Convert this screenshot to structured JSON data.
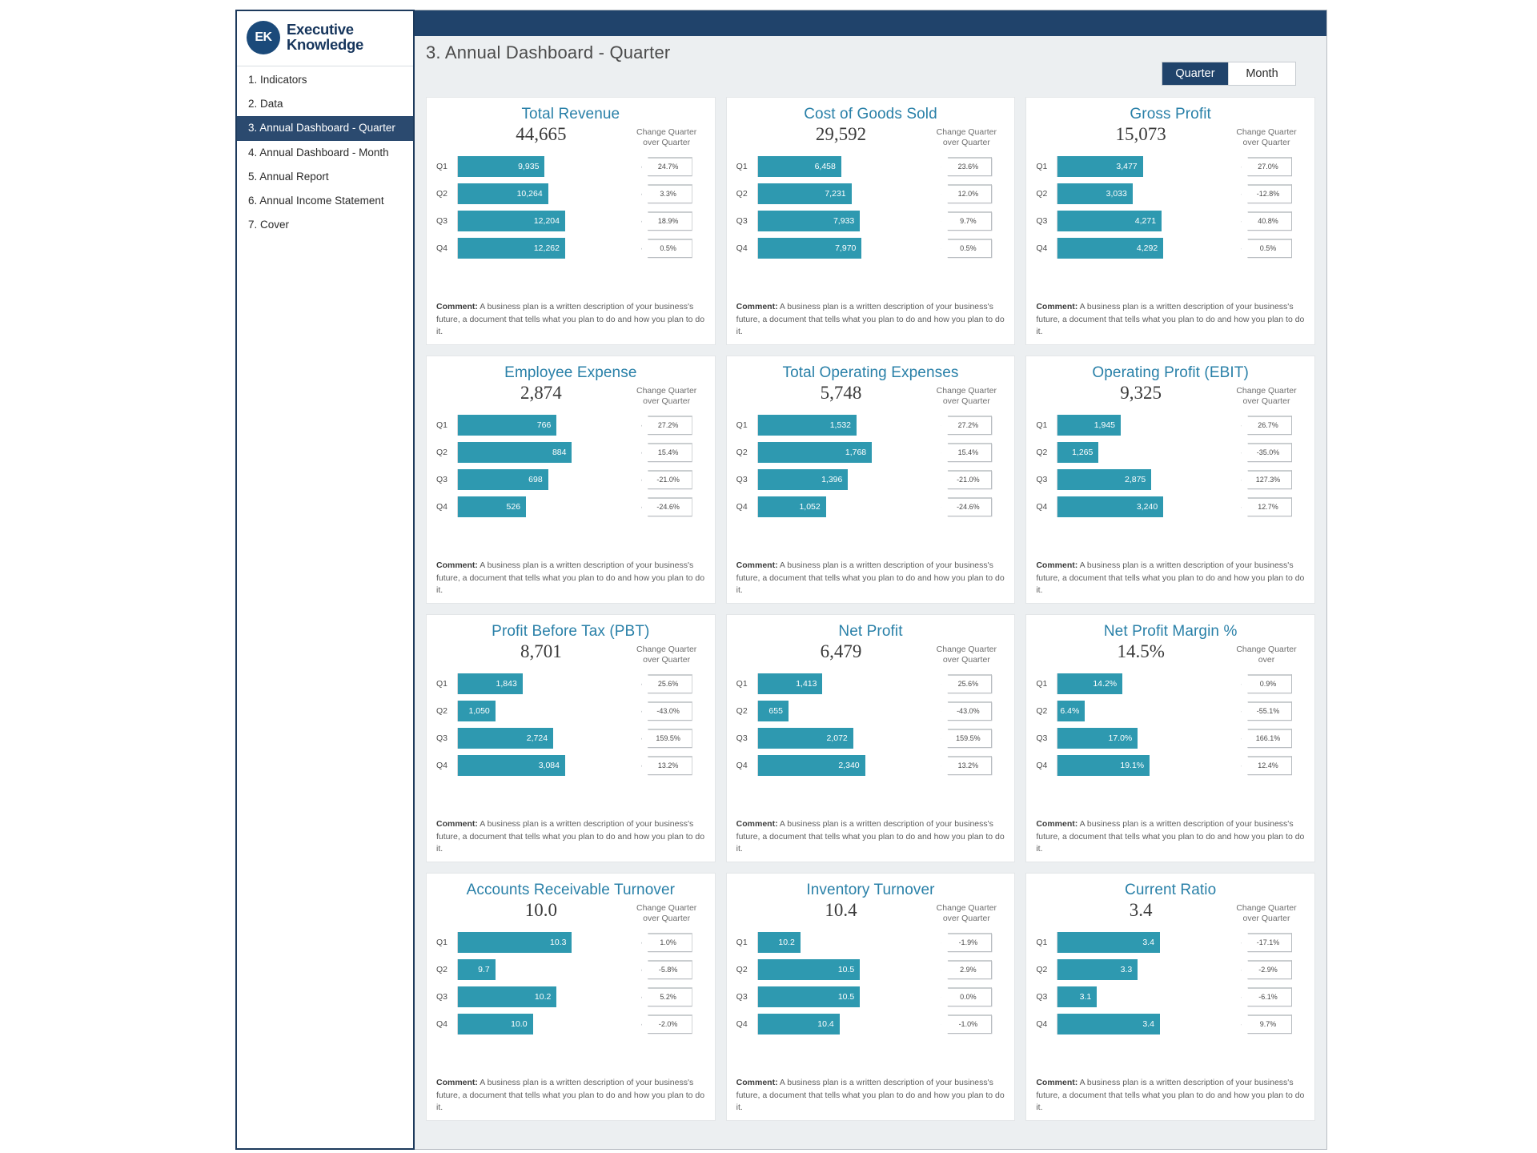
{
  "brand": {
    "mark": "EK",
    "line1": "Executive",
    "line2": "Knowledge"
  },
  "sidebar": {
    "items": [
      {
        "label": "1. Indicators",
        "active": false
      },
      {
        "label": "2. Data",
        "active": false
      },
      {
        "label": "3. Annual Dashboard - Quarter",
        "active": true
      },
      {
        "label": "4. Annual Dashboard - Month",
        "active": false
      },
      {
        "label": "5. Annual Report",
        "active": false
      },
      {
        "label": "6. Annual Income Statement",
        "active": false
      },
      {
        "label": "7. Cover",
        "active": false
      }
    ]
  },
  "header": {
    "title": "3. Annual Dashboard - Quarter",
    "toggle": [
      {
        "label": "Quarter",
        "active": true
      },
      {
        "label": "Month",
        "active": false
      }
    ]
  },
  "labels": {
    "change_header": "Change Quarter over Quarter",
    "change_header_short": "Change Quarter over",
    "comment_prefix": "Comment:",
    "comment_body": "A business plan is a written description of your business's future, a document that tells what you plan to do and how you plan to do it."
  },
  "colors": {
    "bar": "#2e99b0",
    "accent": "#20436b",
    "title": "#2980a8",
    "panel": "#eceff1"
  },
  "chart_data": [
    {
      "type": "bar",
      "title": "Total Revenue",
      "total": "44,665",
      "categories": [
        "Q1",
        "Q2",
        "Q3",
        "Q4"
      ],
      "values": [
        9935,
        10264,
        12204,
        12262
      ],
      "value_labels": [
        "9,935",
        "10,264",
        "12,204",
        "12,262"
      ],
      "bar_pct": [
        51,
        53,
        63,
        63
      ],
      "change": [
        "24.7%",
        "3.3%",
        "18.9%",
        "0.5%"
      ],
      "change_header": "Change Quarter over Quarter",
      "xlabel": "",
      "ylabel": "",
      "comment": "A business plan is a written description of your business's future, a document that tells what you plan to do and how you plan to do it."
    },
    {
      "type": "bar",
      "title": "Cost of Goods Sold",
      "total": "29,592",
      "categories": [
        "Q1",
        "Q2",
        "Q3",
        "Q4"
      ],
      "values": [
        6458,
        7231,
        7933,
        7970
      ],
      "value_labels": [
        "6,458",
        "7,231",
        "7,933",
        "7,970"
      ],
      "bar_pct": [
        49,
        55,
        60,
        61
      ],
      "change": [
        "23.6%",
        "12.0%",
        "9.7%",
        "0.5%"
      ],
      "change_header": "Change Quarter over Quarter",
      "xlabel": "",
      "ylabel": "",
      "comment": "A business plan is a written description of your business's future, a document that tells what you plan to do and how you plan to do it."
    },
    {
      "type": "bar",
      "title": "Gross Profit",
      "total": "15,073",
      "categories": [
        "Q1",
        "Q2",
        "Q3",
        "Q4"
      ],
      "values": [
        3477,
        3033,
        4271,
        4292
      ],
      "value_labels": [
        "3,477",
        "3,033",
        "4,271",
        "4,292"
      ],
      "bar_pct": [
        50,
        44,
        61,
        62
      ],
      "change": [
        "27.0%",
        "-12.8%",
        "40.8%",
        "0.5%"
      ],
      "change_header": "Change Quarter over Quarter",
      "xlabel": "",
      "ylabel": "",
      "comment": "A business plan is a written description of your business's future, a document that tells what you plan to do and how you plan to do it."
    },
    {
      "type": "bar",
      "title": "Employee Expense",
      "total": "2,874",
      "categories": [
        "Q1",
        "Q2",
        "Q3",
        "Q4"
      ],
      "values": [
        766,
        884,
        698,
        526
      ],
      "value_labels": [
        "766",
        "884",
        "698",
        "526"
      ],
      "bar_pct": [
        58,
        67,
        53,
        40
      ],
      "change": [
        "27.2%",
        "15.4%",
        "-21.0%",
        "-24.6%"
      ],
      "change_header": "Change Quarter over Quarter",
      "xlabel": "",
      "ylabel": "",
      "comment": "A business plan is a written description of your business's future, a document that tells what you plan to do and how you plan to do it."
    },
    {
      "type": "bar",
      "title": "Total Operating Expenses",
      "total": "5,748",
      "categories": [
        "Q1",
        "Q2",
        "Q3",
        "Q4"
      ],
      "values": [
        1532,
        1768,
        1396,
        1052
      ],
      "value_labels": [
        "1,532",
        "1,768",
        "1,396",
        "1,052"
      ],
      "bar_pct": [
        58,
        67,
        53,
        40
      ],
      "change": [
        "27.2%",
        "15.4%",
        "-21.0%",
        "-24.6%"
      ],
      "change_header": "Change Quarter over Quarter",
      "xlabel": "",
      "ylabel": "",
      "comment": "A business plan is a written description of your business's future, a document that tells what you plan to do and how you plan to do it."
    },
    {
      "type": "bar",
      "title": "Operating Profit (EBIT)",
      "total": "9,325",
      "categories": [
        "Q1",
        "Q2",
        "Q3",
        "Q4"
      ],
      "values": [
        1945,
        1265,
        2875,
        3240
      ],
      "value_labels": [
        "1,945",
        "1,265",
        "2,875",
        "3,240"
      ],
      "bar_pct": [
        37,
        24,
        55,
        62
      ],
      "change": [
        "26.7%",
        "-35.0%",
        "127.3%",
        "12.7%"
      ],
      "change_header": "Change Quarter over Quarter",
      "xlabel": "",
      "ylabel": "",
      "comment": "A business plan is a written description of your business's future, a document that tells what you plan to do and how you plan to do it."
    },
    {
      "type": "bar",
      "title": "Profit Before Tax (PBT)",
      "total": "8,701",
      "categories": [
        "Q1",
        "Q2",
        "Q3",
        "Q4"
      ],
      "values": [
        1843,
        1050,
        2724,
        3084
      ],
      "value_labels": [
        "1,843",
        "1,050",
        "2,724",
        "3,084"
      ],
      "bar_pct": [
        38,
        22,
        56,
        63
      ],
      "change": [
        "25.6%",
        "-43.0%",
        "159.5%",
        "13.2%"
      ],
      "change_header": "Change Quarter over Quarter",
      "xlabel": "",
      "ylabel": "",
      "comment": "A business plan is a written description of your business's future, a document that tells what you plan to do and how you plan to do it."
    },
    {
      "type": "bar",
      "title": "Net Profit",
      "total": "6,479",
      "categories": [
        "Q1",
        "Q2",
        "Q3",
        "Q4"
      ],
      "values": [
        1413,
        655,
        2072,
        2340
      ],
      "value_labels": [
        "1,413",
        "655",
        "2,072",
        "2,340"
      ],
      "bar_pct": [
        38,
        18,
        56,
        63
      ],
      "change": [
        "25.6%",
        "-43.0%",
        "159.5%",
        "13.2%"
      ],
      "change_header": "Change Quarter over Quarter",
      "xlabel": "",
      "ylabel": "",
      "comment": "A business plan is a written description of your business's future, a document that tells what you plan to do and how you plan to do it."
    },
    {
      "type": "bar",
      "title": "Net Profit Margin %",
      "total": "14.5%",
      "categories": [
        "Q1",
        "Q2",
        "Q3",
        "Q4"
      ],
      "values": [
        14.2,
        6.4,
        17.0,
        19.1
      ],
      "value_labels": [
        "14.2%",
        "6.4%",
        "17.0%",
        "19.1%"
      ],
      "bar_pct": [
        38,
        16,
        47,
        54
      ],
      "change": [
        "0.9%",
        "-55.1%",
        "166.1%",
        "12.4%"
      ],
      "change_header": "Change Quarter over",
      "xlabel": "",
      "ylabel": "",
      "comment": "A business plan is a written description of your business's future, a document that tells what you plan to do and how you plan to do it."
    },
    {
      "type": "bar",
      "title": "Accounts Receivable Turnover",
      "total": "10.0",
      "categories": [
        "Q1",
        "Q2",
        "Q3",
        "Q4"
      ],
      "values": [
        10.3,
        9.7,
        10.2,
        10.0
      ],
      "value_labels": [
        "10.3",
        "9.7",
        "10.2",
        "10.0"
      ],
      "bar_pct": [
        67,
        22,
        58,
        44
      ],
      "change": [
        "1.0%",
        "-5.8%",
        "5.2%",
        "-2.0%"
      ],
      "change_header": "Change Quarter over Quarter",
      "xlabel": "",
      "ylabel": "",
      "comment": "A business plan is a written description of your business's future, a document that tells what you plan to do and how you plan to do it."
    },
    {
      "type": "bar",
      "title": "Inventory Turnover",
      "total": "10.4",
      "categories": [
        "Q1",
        "Q2",
        "Q3",
        "Q4"
      ],
      "values": [
        10.2,
        10.5,
        10.5,
        10.4
      ],
      "value_labels": [
        "10.2",
        "10.5",
        "10.5",
        "10.4"
      ],
      "bar_pct": [
        25,
        60,
        60,
        48
      ],
      "change": [
        "-1.9%",
        "2.9%",
        "0.0%",
        "-1.0%"
      ],
      "change_header": "Change Quarter over Quarter",
      "xlabel": "",
      "ylabel": "",
      "comment": "A business plan is a written description of your business's future, a document that tells what you plan to do and how you plan to do it."
    },
    {
      "type": "bar",
      "title": "Current Ratio",
      "total": "3.4",
      "categories": [
        "Q1",
        "Q2",
        "Q3",
        "Q4"
      ],
      "values": [
        3.4,
        3.3,
        3.1,
        3.4
      ],
      "value_labels": [
        "3.4",
        "3.3",
        "3.1",
        "3.4"
      ],
      "bar_pct": [
        60,
        47,
        23,
        60
      ],
      "change": [
        "-17.1%",
        "-2.9%",
        "-6.1%",
        "9.7%"
      ],
      "change_header": "Change Quarter over Quarter",
      "xlabel": "",
      "ylabel": "",
      "comment": "A business plan is a written description of your business's future, a document that tells what you plan to do and how you plan to do it."
    }
  ]
}
